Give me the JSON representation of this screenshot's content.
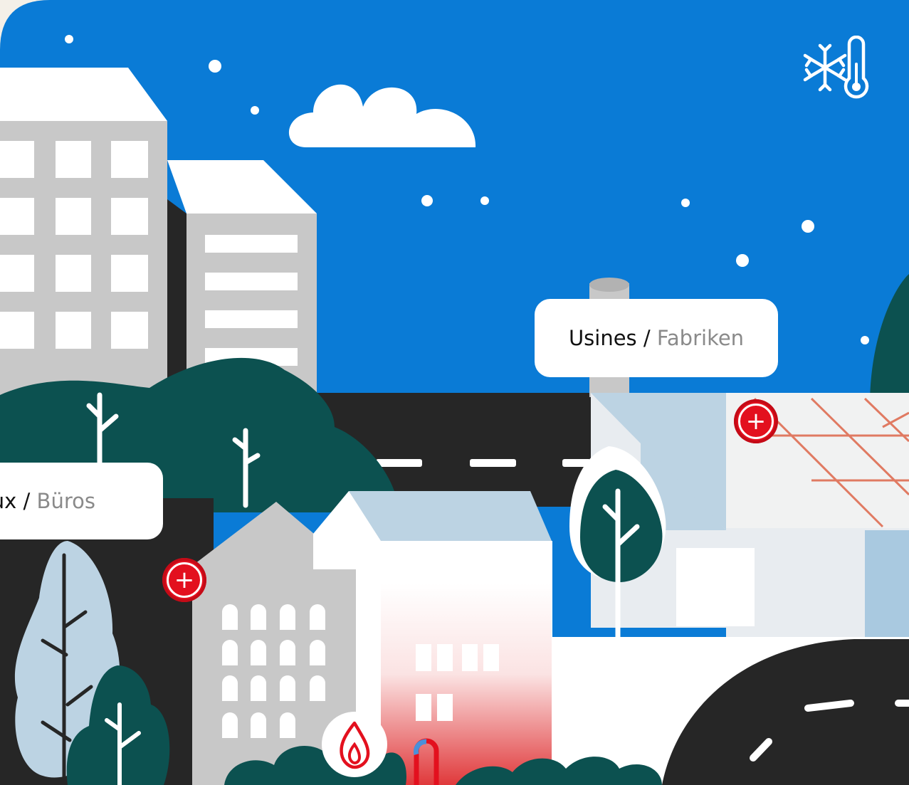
{
  "labels": {
    "factories": {
      "fr": "Usines",
      "separator": " / ",
      "de": "Fabriken"
    },
    "offices": {
      "fr": "aux",
      "separator": " / ",
      "de": "Büros"
    }
  },
  "icons": {
    "climate": "snowflake-thermometer-icon",
    "heat": "flame-icon",
    "hotspot": "plus-icon"
  },
  "hotspots": {
    "plus_symbol": "+"
  },
  "colors": {
    "sky": "#0a7bd6",
    "road": "#262626",
    "tree_dark": "#0c5150",
    "accent_red": "#e3101e",
    "building_gray": "#c8c8c8",
    "building_light_blue": "#bcd3e3"
  }
}
